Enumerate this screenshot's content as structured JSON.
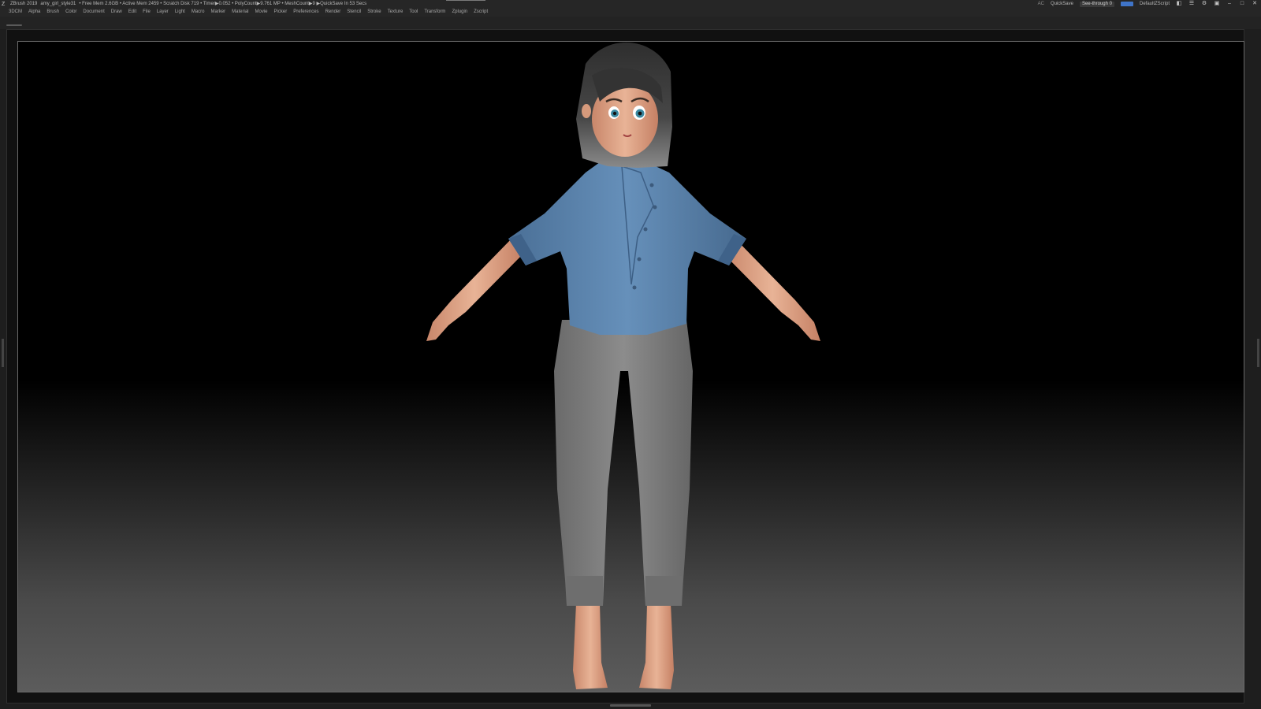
{
  "titlebar": {
    "app": "ZBrush 2019",
    "document_name": "amy_girl_style31",
    "status": "• Free Mem 2.6GB • Active Mem 2459 • Scratch Disk 719 • Timer▶0.052 • PolyCount▶9.761 MP • MeshCount▶9 ▶QuickSave In 53 Secs",
    "ac_label": "AC",
    "quicksave_label": "QuickSave",
    "see_through_label": "See-through 0",
    "see_through_value": 0,
    "script_label": "DefaultZScript"
  },
  "menubar": {
    "items": [
      "3DCM",
      "Alpha",
      "Brush",
      "Color",
      "Document",
      "Draw",
      "Edit",
      "File",
      "Layer",
      "Light",
      "Macro",
      "Marker",
      "Material",
      "Movie",
      "Picker",
      "Preferences",
      "Render",
      "Stencil",
      "Stroke",
      "Texture",
      "Tool",
      "Transform",
      "Zplugin",
      "Zscript"
    ]
  },
  "icons": {
    "app_logo": "zbrush-logo-icon",
    "window_controls": [
      "swatch-icon",
      "layout-icon",
      "menu-icon",
      "dock-icon",
      "minimize-icon",
      "maximize-icon",
      "close-icon"
    ]
  },
  "colors": {
    "shirt": "#5880a8",
    "pants": "#7a7a7a",
    "skin": "#e0a888",
    "hair": "#3c3c3c",
    "accent": "#3f74c8"
  },
  "canvas": {
    "subject": "3D character model"
  }
}
